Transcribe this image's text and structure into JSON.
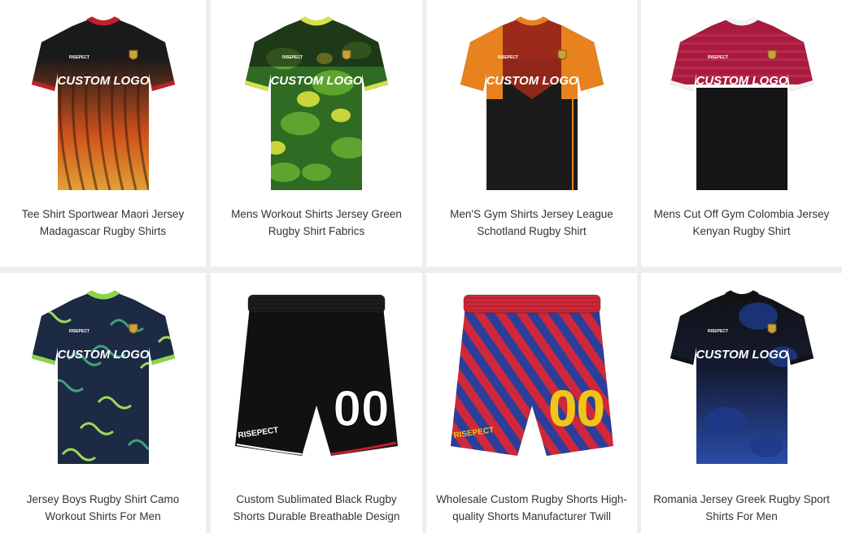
{
  "products": [
    {
      "title": "Tee Shirt Sportwear Maori Jersey Madagascar Rugby Shirts",
      "kind": "jersey",
      "primary": "#1a1a1a",
      "accent": "#d9541c",
      "accent2": "#f0b13a",
      "collar": "#c0202a",
      "logo_text": "CUSTOM LOGO",
      "brand": "RISEPECT"
    },
    {
      "title": "Mens Workout Shirts Jersey Green Rugby Shirt Fabrics",
      "kind": "jersey",
      "primary": "#2f6b22",
      "accent": "#5ea530",
      "accent2": "#c8d43a",
      "collar": "#d6e04a",
      "logo_text": "CUSTOM LOGO",
      "brand": "RISEPECT"
    },
    {
      "title": "Men'S Gym Shirts Jersey League Schotland Rugby Shirt",
      "kind": "jersey",
      "primary": "#1b1b1b",
      "accent": "#e8821e",
      "accent2": "#9c2a1c",
      "collar": "#e8821e",
      "logo_text": "CUSTOM LOGO",
      "brand": "RISEPECT"
    },
    {
      "title": "Mens Cut Off Gym Colombia Jersey Kenyan Rugby Shirt",
      "kind": "jersey",
      "primary": "#151515",
      "accent": "#a81b3e",
      "accent2": "#c53358",
      "collar": "#f2f2f2",
      "logo_text": "CUSTOM LOGO",
      "brand": "RISEPECT"
    },
    {
      "title": "Jersey Boys Rugby Shirt Camo Workout Shirts For Men",
      "kind": "jersey",
      "primary": "#1c2a44",
      "accent": "#3fa27a",
      "accent2": "#9ed85a",
      "collar": "#8cd54a",
      "logo_text": "CUSTOM LOGO",
      "brand": "RISEPECT"
    },
    {
      "title": "Custom Sublimated Black Rugby Shorts Durable Breathable Design",
      "kind": "shorts",
      "primary": "#111111",
      "accent": "#ffffff",
      "accent2": "#c21d2a",
      "number": "00",
      "brand": "RISEPECT"
    },
    {
      "title": "Wholesale Custom Rugby Shorts High-quality Shorts Manufacturer Twill",
      "kind": "shorts",
      "primary": "#d0273a",
      "accent": "#2b3f9a",
      "accent2": "#f2c418",
      "number": "00",
      "brand": "RISEPECT"
    },
    {
      "title": "Romania Jersey Greek Rugby Sport Shirts For Men",
      "kind": "jersey",
      "primary": "#121212",
      "accent": "#1e3a8a",
      "accent2": "#2b4fb0",
      "collar": "#121212",
      "logo_text": "CUSTOM LOGO",
      "brand": "RISEPECT"
    }
  ]
}
